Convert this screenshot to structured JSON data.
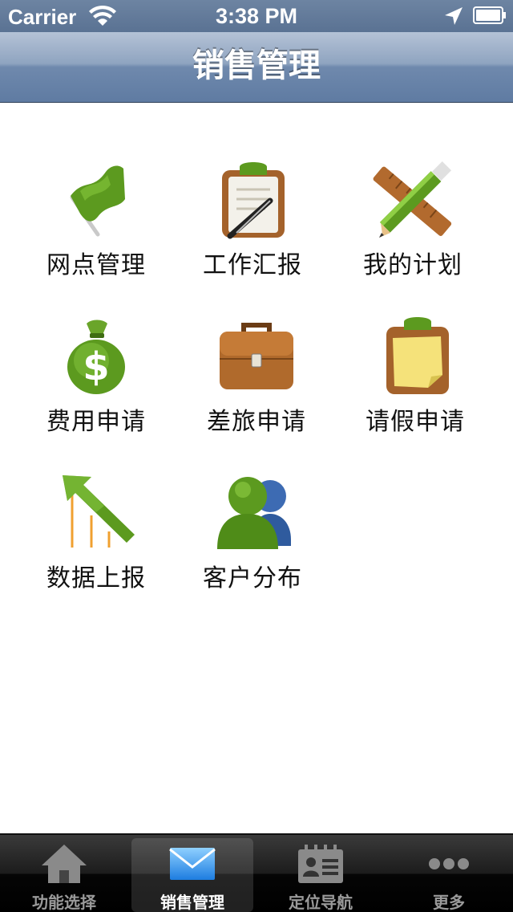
{
  "status_bar": {
    "carrier": "Carrier",
    "time": "3:38 PM"
  },
  "nav": {
    "title": "销售管理"
  },
  "menu": [
    {
      "label": "网点管理",
      "icon": "green-flag-icon"
    },
    {
      "label": "工作汇报",
      "icon": "clipboard-pen-icon"
    },
    {
      "label": "我的计划",
      "icon": "ruler-pencil-icon"
    },
    {
      "label": "费用申请",
      "icon": "money-bag-icon"
    },
    {
      "label": "差旅申请",
      "icon": "briefcase-icon"
    },
    {
      "label": "请假申请",
      "icon": "sticky-note-icon"
    },
    {
      "label": "数据上报",
      "icon": "growth-arrow-icon"
    },
    {
      "label": "客户分布",
      "icon": "users-icon"
    }
  ],
  "tabs": [
    {
      "label": "功能选择",
      "icon": "home-icon",
      "active": false
    },
    {
      "label": "销售管理",
      "icon": "mail-icon",
      "active": true
    },
    {
      "label": "定位导航",
      "icon": "contact-card-icon",
      "active": false
    },
    {
      "label": "更多",
      "icon": "more-icon",
      "active": false
    }
  ],
  "colors": {
    "nav_bar": "#6f89ad",
    "tab_bar": "#1c1c1c",
    "accent_green": "#5a9a1a",
    "accent_brown": "#a0612a"
  }
}
